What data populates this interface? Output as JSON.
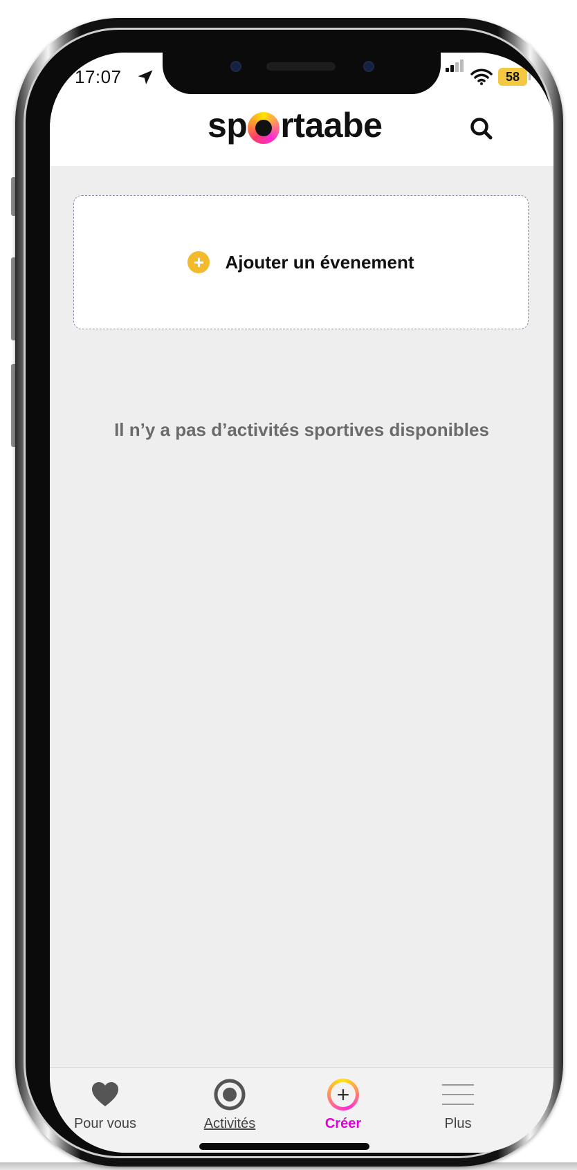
{
  "status_bar": {
    "time": "17:07",
    "battery": "58",
    "location_icon": "location-arrow-icon",
    "signal_icon": "signal-bars-icon",
    "wifi_icon": "wifi-icon"
  },
  "header": {
    "logo_text_left": "sp",
    "logo_text_right": "rtaabe",
    "search_icon": "search-icon"
  },
  "add_event": {
    "label": "Ajouter un évenement",
    "icon": "plus-circle-icon"
  },
  "empty_state": {
    "message": "Il n’y a pas d’activités sportives disponibles"
  },
  "tabbar": {
    "items": [
      {
        "label": "Pour vous",
        "icon": "heart-icon"
      },
      {
        "label": "Activités",
        "icon": "target-icon"
      },
      {
        "label": "Créer",
        "icon": "plus-ring-icon",
        "active": true
      },
      {
        "label": "Plus",
        "icon": "menu-icon"
      }
    ]
  },
  "colors": {
    "accent_magenta": "#e100d8",
    "accent_yellow": "#f3bb2b",
    "background": "#eeeeee",
    "tab_icon": "#555555"
  }
}
